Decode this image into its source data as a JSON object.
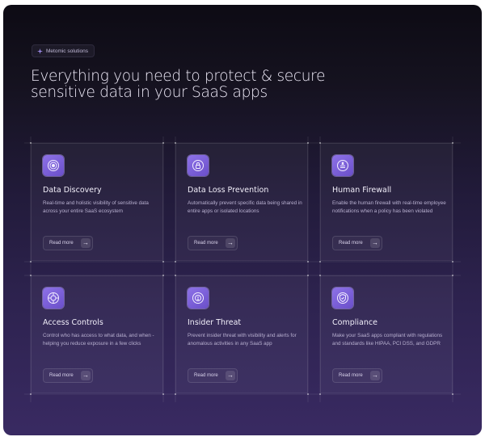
{
  "badge": {
    "label": "Metomic solutions",
    "icon": "sparkle-icon"
  },
  "headline": "Everything you need to protect & secure sensitive data in your SaaS apps",
  "colors": {
    "accent": "#7b5fd9",
    "background_top": "#0d0b14",
    "background_bottom": "#392a62"
  },
  "cards": [
    {
      "title": "Data Discovery",
      "description": "Real-time and holistic visibility of sensitive data across your entire SaaS ecosystem",
      "button": "Read more",
      "icon": "radar-icon"
    },
    {
      "title": "Data Loss Prevention",
      "description": "Automatically prevent specific data being shared in entire apps or isolated locations",
      "button": "Read more",
      "icon": "shield-lock-icon"
    },
    {
      "title": "Human Firewall",
      "description": "Enable the human firewall with real-time employee notifications when a policy has been violated",
      "button": "Read more",
      "icon": "firewall-icon"
    },
    {
      "title": "Access Controls",
      "description": "Control who has access to what data, and when - helping you reduce exposure in a few clicks",
      "button": "Read more",
      "icon": "access-key-icon"
    },
    {
      "title": "Insider Threat",
      "description": "Prevent insider threat with visibility and alerts for anomalous activities in any SaaS app",
      "button": "Read more",
      "icon": "alert-target-icon"
    },
    {
      "title": "Compliance",
      "description": "Make your SaaS apps compliant with regulations and standards like HIPAA, PCI DSS, and GDPR",
      "button": "Read more",
      "icon": "compliance-badge-icon"
    }
  ]
}
